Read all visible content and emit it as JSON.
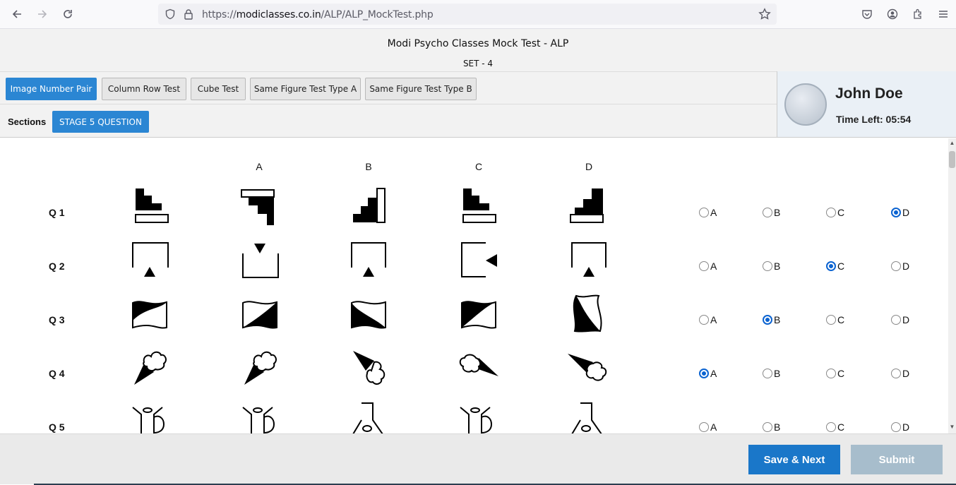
{
  "browser": {
    "url_prefix": "https://",
    "url_host": "modiclasses.co.in",
    "url_path": "/ALP/ALP_MockTest.php"
  },
  "header": {
    "title": "Modi Psycho Classes Mock Test - ALP",
    "set": "SET - 4"
  },
  "tabs": [
    {
      "label": "Image Number Pair",
      "active": true
    },
    {
      "label": "Column Row Test",
      "active": false
    },
    {
      "label": "Cube Test",
      "active": false
    },
    {
      "label": "Same Figure Test Type A",
      "active": false
    },
    {
      "label": "Same Figure Test Type B",
      "active": false
    }
  ],
  "sections": {
    "label": "Sections",
    "button": "STAGE 5 QUESTION"
  },
  "profile": {
    "name": "John Doe",
    "time_left": "Time Left: 05:54"
  },
  "columns": [
    "A",
    "B",
    "C",
    "D"
  ],
  "questions": [
    {
      "label": "Q 1",
      "figure": "staircase",
      "selected": "D"
    },
    {
      "label": "Q 2",
      "figure": "box-triangle",
      "selected": "C"
    },
    {
      "label": "Q 3",
      "figure": "wave-flag",
      "selected": "B"
    },
    {
      "label": "Q 4",
      "figure": "ice-cream-cone",
      "selected": "A"
    },
    {
      "label": "Q 5",
      "figure": "watering-can",
      "selected": null
    }
  ],
  "options": [
    "A",
    "B",
    "C",
    "D"
  ],
  "footer": {
    "save_label": "Save & Next",
    "submit_label": "Submit"
  },
  "colors": {
    "primary": "#2b86d3",
    "save": "#1a77c9",
    "submit_disabled": "#a7bdcc",
    "radio_checked": "#0b63d1"
  }
}
